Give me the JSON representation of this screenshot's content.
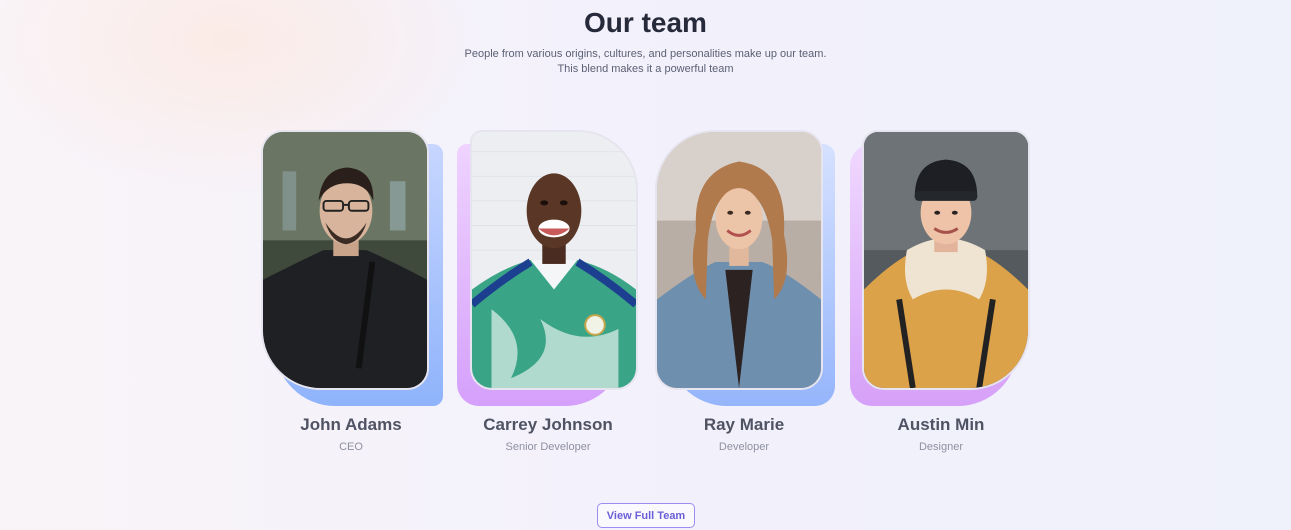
{
  "section": {
    "title": "Our team",
    "subtitle_line1": "People from various origins, cultures, and personalities make up our team.",
    "subtitle_line2": "This blend makes it a powerful team"
  },
  "members": [
    {
      "name": "John Adams",
      "role": "CEO"
    },
    {
      "name": "Carrey Johnson",
      "role": "Senior Developer"
    },
    {
      "name": "Ray Marie",
      "role": "Developer"
    },
    {
      "name": "Austin Min",
      "role": "Designer"
    }
  ],
  "cta": {
    "label": "View Full Team"
  },
  "colors": {
    "accent": "#6b5fd8",
    "blue_backing": "#8fb3fb",
    "purple_backing": "#d5a0fb",
    "title": "#262a3a"
  }
}
